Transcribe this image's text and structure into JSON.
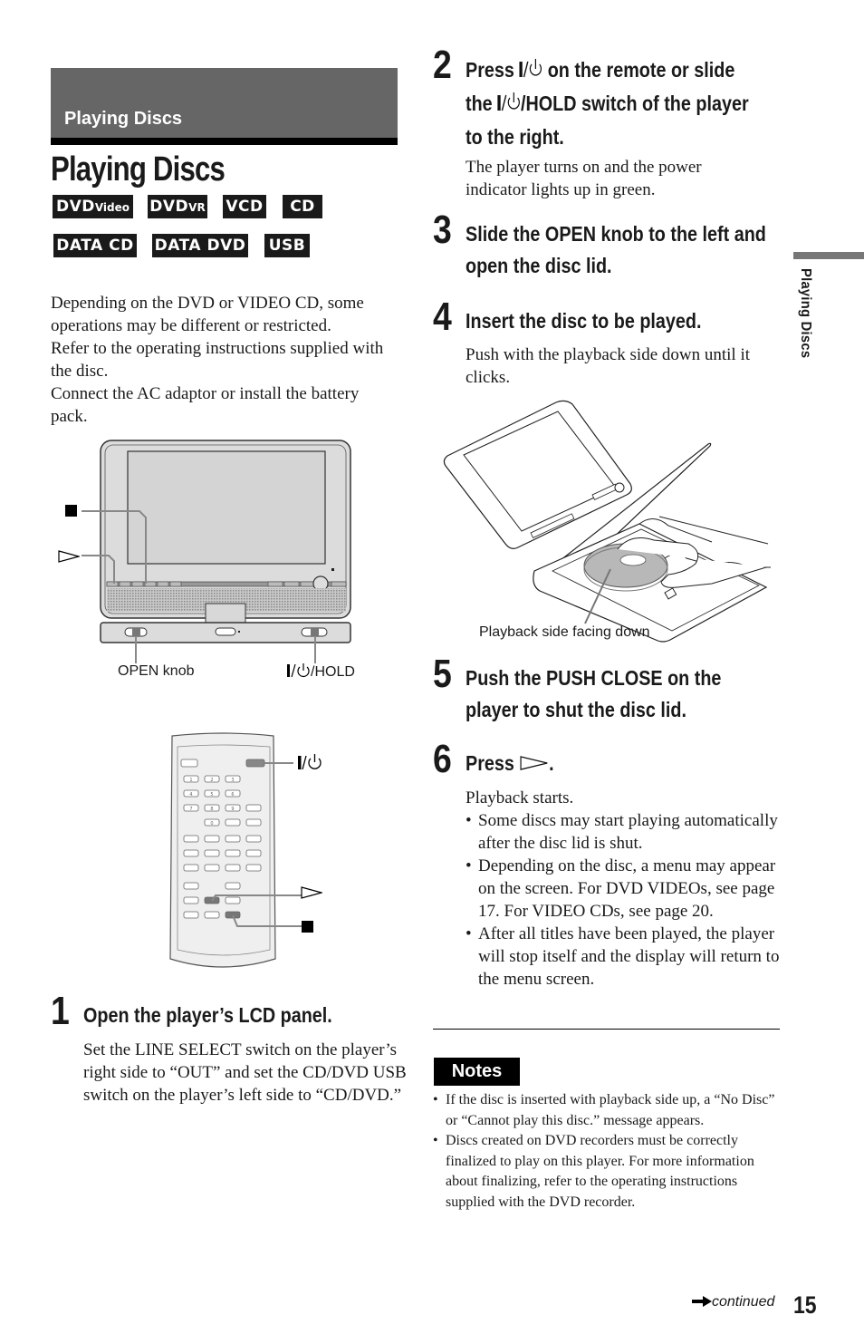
{
  "section_header": {
    "label": "Playing Discs"
  },
  "page_title": "Playing Discs",
  "disc_badges": [
    {
      "main": "DVD",
      "sub": "Video"
    },
    {
      "main": "DVD",
      "sub": "VR"
    },
    {
      "main": "VCD",
      "sub": ""
    },
    {
      "main": "CD",
      "sub": ""
    },
    {
      "main": "DATA CD",
      "sub": ""
    },
    {
      "main": "DATA DVD",
      "sub": ""
    },
    {
      "main": "USB",
      "sub": ""
    }
  ],
  "intro": [
    "Depending on the DVD or VIDEO CD, some operations may be different or restricted.",
    "Refer to the operating instructions supplied with the disc.",
    "Connect the AC adaptor or install the battery pack."
  ],
  "player_figure": {
    "labels": {
      "stop": "stop-icon",
      "play": "play-icon",
      "open_knob": "OPEN knob",
      "power_hold_suffix": "/HOLD"
    }
  },
  "remote_figure": {
    "labels": {
      "power": "power-icon",
      "play": "play-icon",
      "stop": "stop-icon"
    },
    "keypad": [
      "1",
      "2",
      "3",
      "4",
      "5",
      "6",
      "7",
      "8",
      "9",
      "0"
    ]
  },
  "steps": [
    {
      "number": "1",
      "title": "Open the player’s LCD panel.",
      "body": "Set the LINE SELECT switch on the player’s right side to “OUT” and set the CD/DVD USB switch on the player’s left side to “CD/DVD.”"
    },
    {
      "number": "2",
      "title_lines": [
        [
          "Press ",
          "power-icon",
          " on the remote or slide"
        ],
        [
          "the ",
          "power-icon",
          "/HOLD switch of the player"
        ],
        [
          "to the right."
        ]
      ],
      "body": "The player turns on and the power indicator lights up in green."
    },
    {
      "number": "3",
      "title_lines": [
        "Slide the OPEN knob to the left and",
        "open the disc lid."
      ]
    },
    {
      "number": "4",
      "title": "Insert the disc to be played.",
      "body": "Push with the playback side down until it clicks."
    },
    {
      "number": "5",
      "title_lines": [
        "Push the PUSH CLOSE on the",
        "player to shut the disc lid."
      ]
    },
    {
      "number": "6",
      "title_prefix": "Press ",
      "title_suffix": ".",
      "body_intro": "Playback starts.",
      "bullets": [
        "Some discs may start playing automatically after the disc lid is shut.",
        "Depending on the disc, a menu may appear on the screen. For DVD VIDEOs, see page 17. For VIDEO CDs, see page 20.",
        "After all titles have been played, the player will stop itself and the display will return to the menu screen."
      ]
    }
  ],
  "insert_figure": {
    "caption": "Playback side facing down"
  },
  "notes": {
    "label": "Notes",
    "items": [
      "If the disc is inserted with playback side up, a “No Disc” or “Cannot play this disc.” message appears.",
      "Discs created on DVD recorders must be correctly finalized to play on this player. For more information about finalizing, refer to the operating instructions supplied with the DVD recorder."
    ]
  },
  "side_tab": "Playing Discs",
  "footer": {
    "continued": "continued",
    "page_number": "15"
  },
  "colors": {
    "banner": "#666666",
    "side_tab_bar": "#777777",
    "badge_bg": "#1a1a1a",
    "text": "#1a1a1a"
  }
}
